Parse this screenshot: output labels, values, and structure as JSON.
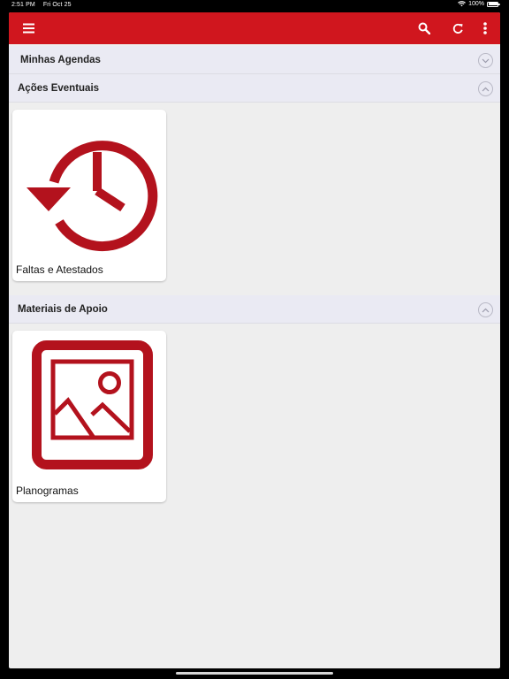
{
  "status_bar": {
    "time": "2:51 PM",
    "date": "Fri Oct 25",
    "battery": "100%"
  },
  "toolbar": {
    "color": "#d0161e",
    "icons": [
      "hamburger-menu-icon",
      "search-icon",
      "refresh-icon",
      "more-vertical-icon"
    ]
  },
  "sections": [
    {
      "title": "Minhas Agendas",
      "expanded": false
    },
    {
      "title": "Ações Eventuais",
      "expanded": true,
      "items": [
        {
          "label": "Faltas e Atestados",
          "icon": "history-icon"
        }
      ]
    },
    {
      "title": "Materiais de Apoio",
      "expanded": true,
      "items": [
        {
          "label": "Planogramas",
          "icon": "image-icon"
        }
      ]
    }
  ],
  "colors": {
    "accent": "#d0161e",
    "icon_red": "#b3121d"
  }
}
